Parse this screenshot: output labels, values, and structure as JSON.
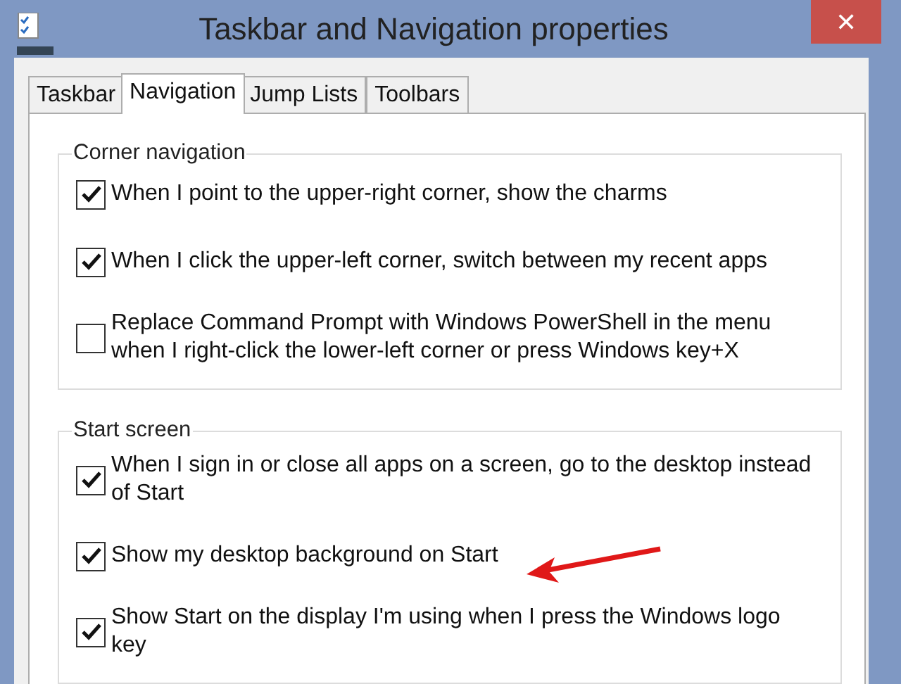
{
  "window": {
    "title": "Taskbar and Navigation properties",
    "close": "✕"
  },
  "tabs": [
    {
      "label": "Taskbar",
      "selected": false
    },
    {
      "label": "Navigation",
      "selected": true
    },
    {
      "label": "Jump Lists",
      "selected": false
    },
    {
      "label": "Toolbars",
      "selected": false
    }
  ],
  "groups": [
    {
      "title": "Corner navigation",
      "options": [
        {
          "label": "When I point to the upper-right corner, show the charms",
          "checked": true
        },
        {
          "label": "When I click the upper-left corner, switch between my recent apps",
          "checked": true
        },
        {
          "label": "Replace Command Prompt with Windows PowerShell in the menu when I right-click the lower-left corner or press Windows key+X",
          "checked": false
        }
      ]
    },
    {
      "title": "Start screen",
      "options": [
        {
          "label": "When I sign in or close all apps on a screen, go to the desktop instead of Start",
          "checked": true
        },
        {
          "label": "Show my desktop background on Start",
          "checked": true
        },
        {
          "label": "Show Start on the display I'm using when I press the Windows logo key",
          "checked": true
        }
      ]
    }
  ]
}
